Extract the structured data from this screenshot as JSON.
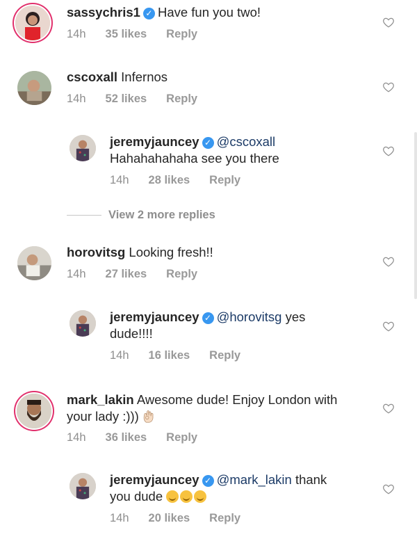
{
  "comments": [
    {
      "username": "sassychris1",
      "verified": true,
      "text": "Have fun you two!",
      "time": "14h",
      "likes": "35 likes",
      "reply": "Reply"
    },
    {
      "username": "cscoxall",
      "text": "Infernos",
      "time": "14h",
      "likes": "52 likes",
      "reply": "Reply"
    },
    {
      "username": "jeremyjauncey",
      "verified": true,
      "mention": "@cscoxall",
      "text": "Hahahahahaha see you there",
      "time": "14h",
      "likes": "28 likes",
      "reply": "Reply"
    },
    {
      "username": "horovitsg",
      "text": "Looking fresh!!",
      "time": "14h",
      "likes": "27 likes",
      "reply": "Reply"
    },
    {
      "username": "jeremyjauncey",
      "verified": true,
      "mention": "@horovitsg",
      "text_line1": "yes",
      "text_line2": "dude!!!!",
      "time": "14h",
      "likes": "16 likes",
      "reply": "Reply"
    },
    {
      "username": "mark_lakin",
      "text_line1": "Awesome dude! Enjoy London with",
      "text_line2": "your lady :)))",
      "emoji": "ok-hand-emoji",
      "time": "14h",
      "likes": "36 likes",
      "reply": "Reply"
    },
    {
      "username": "jeremyjauncey",
      "verified": true,
      "mention": "@mark_lakin",
      "text_line1": "thank",
      "text_line2": "you dude",
      "emoji": "smiling-face-emoji",
      "time": "14h",
      "likes": "20 likes",
      "reply": "Reply"
    }
  ],
  "view_more": "View 2 more replies",
  "colors": {
    "username": "#262626",
    "mention": "#1c3b67",
    "meta": "#8e8e8e",
    "verified": "#3897f0",
    "story_ring": "#e1306c"
  }
}
